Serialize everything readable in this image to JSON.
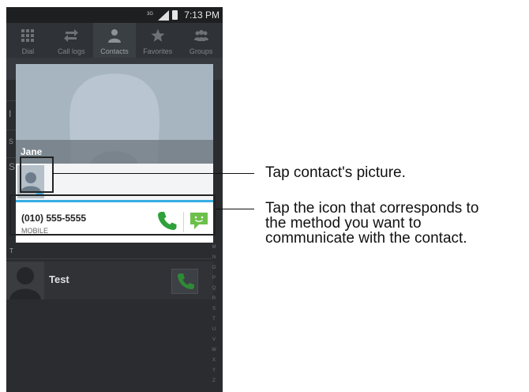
{
  "status_bar": {
    "network": "3G",
    "time": "7:13 PM"
  },
  "tabs": [
    {
      "label": "Dial",
      "icon": "dialpad-icon",
      "active": false
    },
    {
      "label": "Call logs",
      "icon": "call-logs-icon",
      "active": false
    },
    {
      "label": "Contacts",
      "icon": "person-icon",
      "active": true
    },
    {
      "label": "Favorites",
      "icon": "star-icon",
      "active": false
    },
    {
      "label": "Groups",
      "icon": "group-icon",
      "active": false
    }
  ],
  "background_list": {
    "section_header": "T",
    "contact": {
      "name": "Test",
      "action_icon": "phone-icon"
    },
    "index_letters": [
      "M",
      "N",
      "O",
      "P",
      "Q",
      "R",
      "S",
      "T",
      "U",
      "V",
      "W",
      "X",
      "Y",
      "Z"
    ]
  },
  "quick_contact": {
    "name": "Jane",
    "number": "(010) 555-5555",
    "number_type": "MOBILE",
    "call_icon": "phone-icon",
    "message_icon": "message-icon"
  },
  "callouts": {
    "picture": "Tap contact's picture.",
    "method_lines": [
      "Tap the icon that corresponds to",
      "the method you want to",
      "communicate with the contact."
    ]
  },
  "colors": {
    "accent": "#37aee2",
    "call_green": "#2ea13a",
    "message_green": "#6cc04a",
    "screen_dark": "#2b2e32"
  }
}
